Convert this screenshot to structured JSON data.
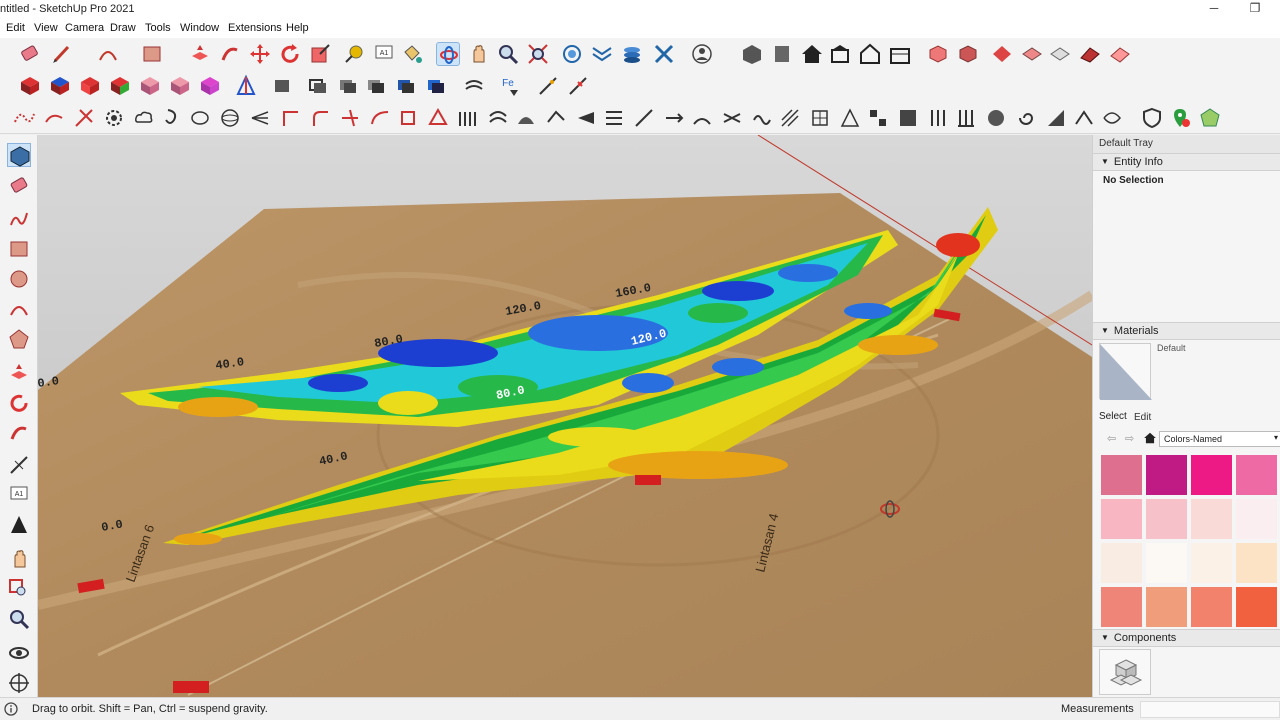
{
  "window": {
    "title": "ntitled - SketchUp Pro 2021",
    "minimize_glyph": "─",
    "maximize_glyph": "❐"
  },
  "menu": {
    "items": [
      "Edit",
      "View",
      "Camera",
      "Draw",
      "Tools",
      "Window",
      "Extensions",
      "Help"
    ]
  },
  "scene": {
    "profile_labels_back": [
      "0.0",
      "40.0",
      "80.0",
      "120.0",
      "160.0"
    ],
    "profile_labels_front": [
      "0.0",
      "40.0",
      "80.0",
      "120.0"
    ],
    "line_labels": [
      "Lintasan 6",
      "Lintasan 4"
    ],
    "colors": {
      "ground": "#b08a5c",
      "sky": "#cfcfcf",
      "red_axis": "#c0392b"
    }
  },
  "tray": {
    "title": "Default Tray",
    "entity_info": {
      "header": "Entity Info",
      "value": "No Selection"
    },
    "materials": {
      "header": "Materials",
      "default_label": "Default",
      "tab_select": "Select",
      "tab_edit": "Edit",
      "library": "Colors-Named",
      "swatches": [
        "#de6f8e",
        "#c01a85",
        "#ed1a86",
        "#ee6aa4",
        "#f8b6c3",
        "#f6c1c8",
        "#f9dad7",
        "#fbeef0",
        "#f9ede3",
        "#fcf9f4",
        "#fbf1e6",
        "#fde3c6",
        "#ef8579",
        "#ef9d7a",
        "#f2826c",
        "#f1613f"
      ]
    },
    "components": {
      "header": "Components"
    }
  },
  "status": {
    "message": "Drag to orbit. Shift = Pan, Ctrl = suspend gravity.",
    "measurements_label": "Measurements",
    "measurements_value": ""
  }
}
